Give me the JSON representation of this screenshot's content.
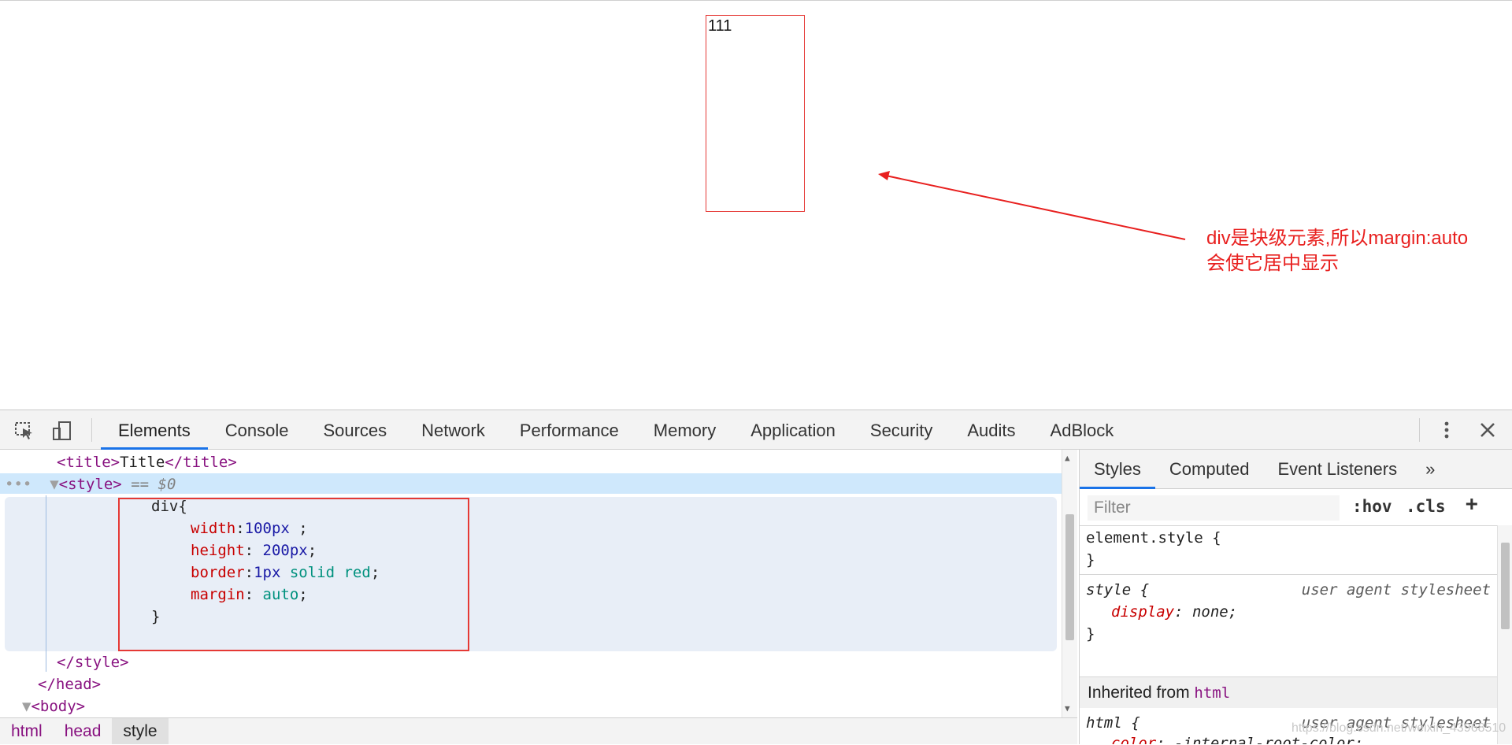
{
  "page": {
    "box_text": "111",
    "annotation": "div是块级元素,所以margin:auto\n会使它居中显示",
    "annotation_color": "#e8201f"
  },
  "devtools": {
    "tabs": [
      "Elements",
      "Console",
      "Sources",
      "Network",
      "Performance",
      "Memory",
      "Application",
      "Security",
      "Audits",
      "AdBlock"
    ],
    "active_tab": "Elements",
    "elements": {
      "title_open": "<title>",
      "title_text": "Title",
      "title_close": "</title>",
      "style_open": "<style>",
      "style_marker": "== $0",
      "css_selector": "div{",
      "css_rules": [
        {
          "prop": "width",
          "sep": ":",
          "value": "100px",
          "tail": " ;"
        },
        {
          "prop": "height",
          "sep": ": ",
          "value": "200px",
          "tail": ";"
        },
        {
          "prop": "border",
          "sep": ":",
          "value": "1px",
          "value2": " solid red",
          "tail": ";"
        },
        {
          "prop": "margin",
          "sep": ": ",
          "value": "auto",
          "tail": ";"
        }
      ],
      "css_close": "}",
      "style_close": "</style>",
      "head_close": "</head>",
      "body_open": "<body>"
    },
    "breadcrumb": [
      "html",
      "head",
      "style"
    ],
    "styles_pane": {
      "tabs": [
        "Styles",
        "Computed",
        "Event Listeners"
      ],
      "active_tab": "Styles",
      "more": "»",
      "filter_placeholder": "Filter",
      "hov": ":hov",
      "cls": ".cls",
      "add": "+",
      "element_style": "element.style {",
      "close_brace": "}",
      "style_rule_selector": "style {",
      "style_rule_source": "user agent stylesheet",
      "style_rule_prop": "display",
      "style_rule_value": "none;",
      "inherited_label": "Inherited from",
      "inherited_tag": "html",
      "html_rule_selector": "html {",
      "html_rule_source": "user agent stylesheet",
      "html_rule_prop": "color",
      "html_rule_value": "-internal-root-color;"
    },
    "watermark": "https://blog.csdn.net/weixin_43968510"
  }
}
